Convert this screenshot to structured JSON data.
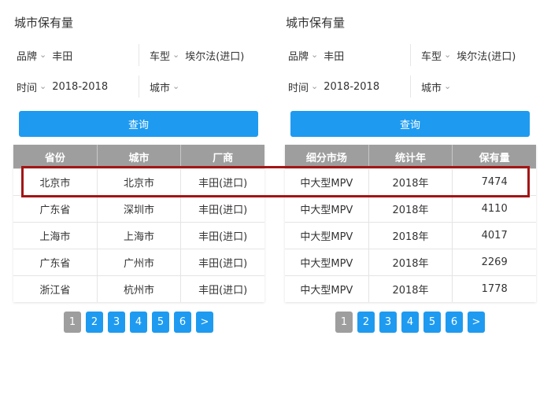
{
  "colors": {
    "accent": "#1e9bf0",
    "header_gray": "#9e9e9e",
    "highlight": "#a31515"
  },
  "left": {
    "title": "城市保有量",
    "filters": [
      {
        "label": "品牌",
        "value": "丰田"
      },
      {
        "label": "车型",
        "value": "埃尔法(进口)"
      },
      {
        "label": "时间",
        "value": "2018-2018"
      },
      {
        "label": "城市",
        "value": ""
      }
    ],
    "query_label": "查询",
    "columns": [
      "省份",
      "城市",
      "厂商"
    ],
    "rows": [
      [
        "北京市",
        "北京市",
        "丰田(进口)"
      ],
      [
        "广东省",
        "深圳市",
        "丰田(进口)"
      ],
      [
        "上海市",
        "上海市",
        "丰田(进口)"
      ],
      [
        "广东省",
        "广州市",
        "丰田(进口)"
      ],
      [
        "浙江省",
        "杭州市",
        "丰田(进口)"
      ]
    ],
    "pages": [
      "1",
      "2",
      "3",
      "4",
      "5",
      "6",
      ">"
    ]
  },
  "right": {
    "title": "城市保有量",
    "filters": [
      {
        "label": "品牌",
        "value": "丰田"
      },
      {
        "label": "车型",
        "value": "埃尔法(进口)"
      },
      {
        "label": "时间",
        "value": "2018-2018"
      },
      {
        "label": "城市",
        "value": ""
      }
    ],
    "query_label": "查询",
    "columns": [
      "细分市场",
      "统计年",
      "保有量"
    ],
    "rows": [
      [
        "中大型MPV",
        "2018年",
        "7474"
      ],
      [
        "中大型MPV",
        "2018年",
        "4110"
      ],
      [
        "中大型MPV",
        "2018年",
        "4017"
      ],
      [
        "中大型MPV",
        "2018年",
        "2269"
      ],
      [
        "中大型MPV",
        "2018年",
        "1778"
      ]
    ],
    "pages": [
      "1",
      "2",
      "3",
      "4",
      "5",
      "6",
      ">"
    ]
  }
}
